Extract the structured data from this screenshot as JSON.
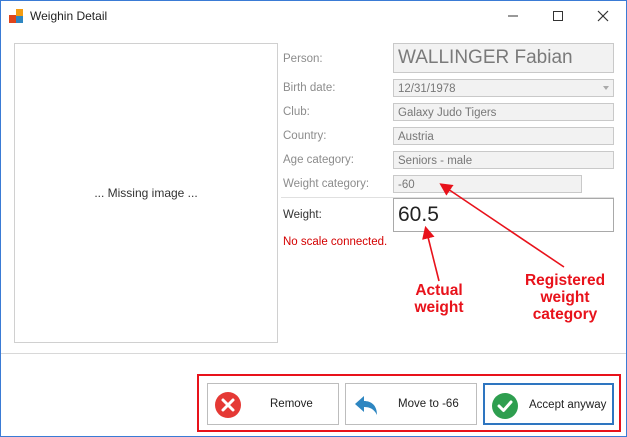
{
  "window": {
    "title": "Weighin Detail"
  },
  "image": {
    "placeholder": "... Missing image ..."
  },
  "fields": {
    "person_label": "Person:",
    "person_value": "WALLINGER Fabian",
    "birth_label": "Birth date:",
    "birth_value": "12/31/1978",
    "club_label": "Club:",
    "club_value": "Galaxy Judo Tigers",
    "country_label": "Country:",
    "country_value": "Austria",
    "age_label": "Age category:",
    "age_value": "Seniors - male",
    "weightcat_label": "Weight category:",
    "weightcat_value": "-60",
    "weight_label": "Weight:",
    "weight_value": "60.5"
  },
  "status": {
    "scale": "No scale connected."
  },
  "annotations": {
    "actual_line1": "Actual",
    "actual_line2": "weight",
    "registered_line1": "Registered",
    "registered_line2": "weight",
    "registered_line3": "category"
  },
  "buttons": {
    "remove": "Remove",
    "move": "Move to -66",
    "accept": "Accept anyway"
  },
  "colors": {
    "accent": "#2e75c0",
    "annotation_red": "#e8121b",
    "remove_icon": "#e53935",
    "move_icon": "#2e86c1",
    "accept_icon": "#2e9e4f"
  }
}
